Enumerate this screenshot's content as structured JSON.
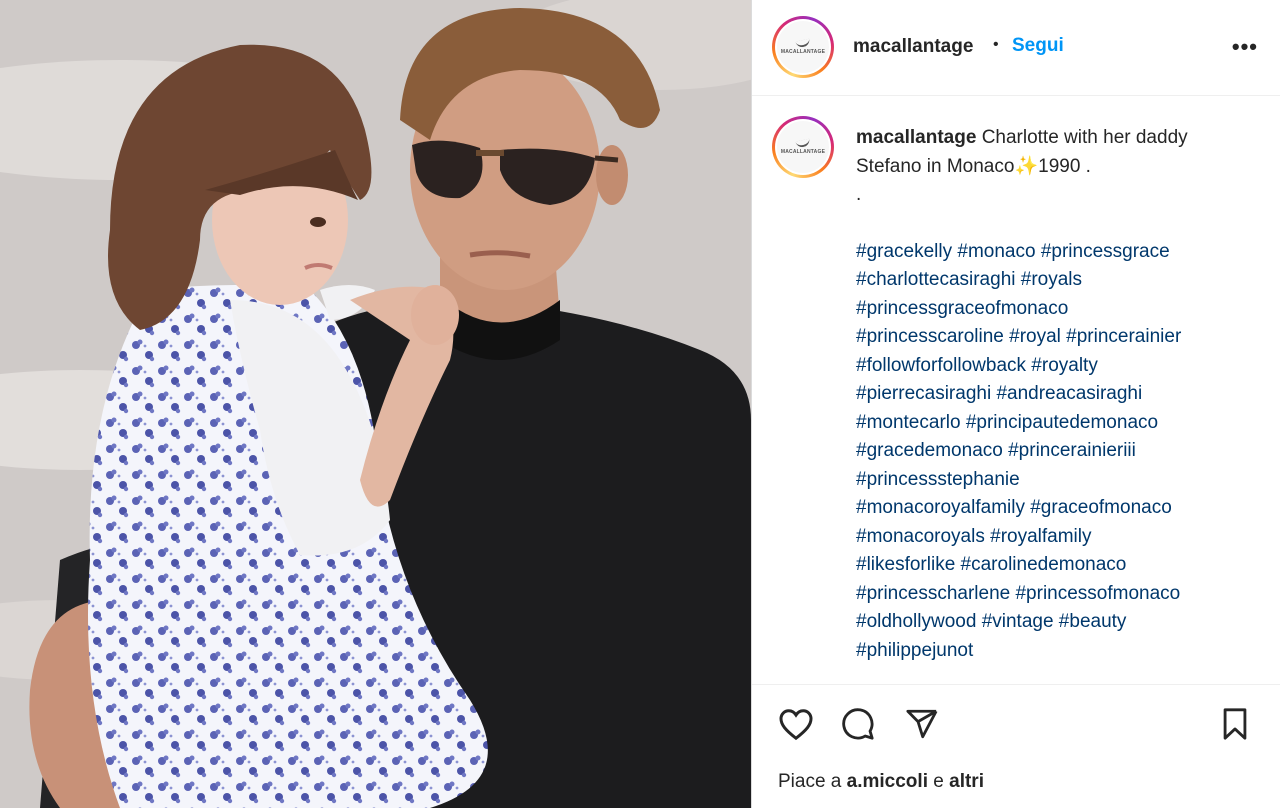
{
  "post": {
    "username": "macallantage",
    "separator": "•",
    "follow_label": "Segui",
    "more_label": "•••",
    "avatar_logo_text": "MACALLANTAGE",
    "caption": {
      "username": "macallantage",
      "line1": "Charlotte with her daddy Stefano in Monaco",
      "emoji": "✨",
      "year": "1990 .",
      "dot_line": ".",
      "hashtags": [
        "#gracekelly #monaco #princessgrace",
        "#charlottecasiraghi #royals",
        "#princessgraceofmonaco",
        "#princesscaroline #royal #princerainier",
        "#followforfollowback #royalty",
        "#pierrecasiraghi #andreacasiraghi",
        "#montecarlo #principautedemonaco",
        "#gracedemonaco #princerainieriii",
        "#princessstephanie",
        "#monacoroyalfamily #graceofmonaco",
        "#monacoroyals #royalfamily",
        "#likesforlike #carolinedemonaco",
        "#princesscharlene #princessofmonaco",
        "#oldhollywood #vintage #beauty",
        "#philippejunot"
      ]
    },
    "likes": {
      "prefix": "Piace a",
      "user": "a.miccoli",
      "middle": "e",
      "others": "altri"
    },
    "icons": {
      "like": "heart-icon",
      "comment": "comment-icon",
      "share": "share-icon",
      "save": "bookmark-icon"
    }
  }
}
